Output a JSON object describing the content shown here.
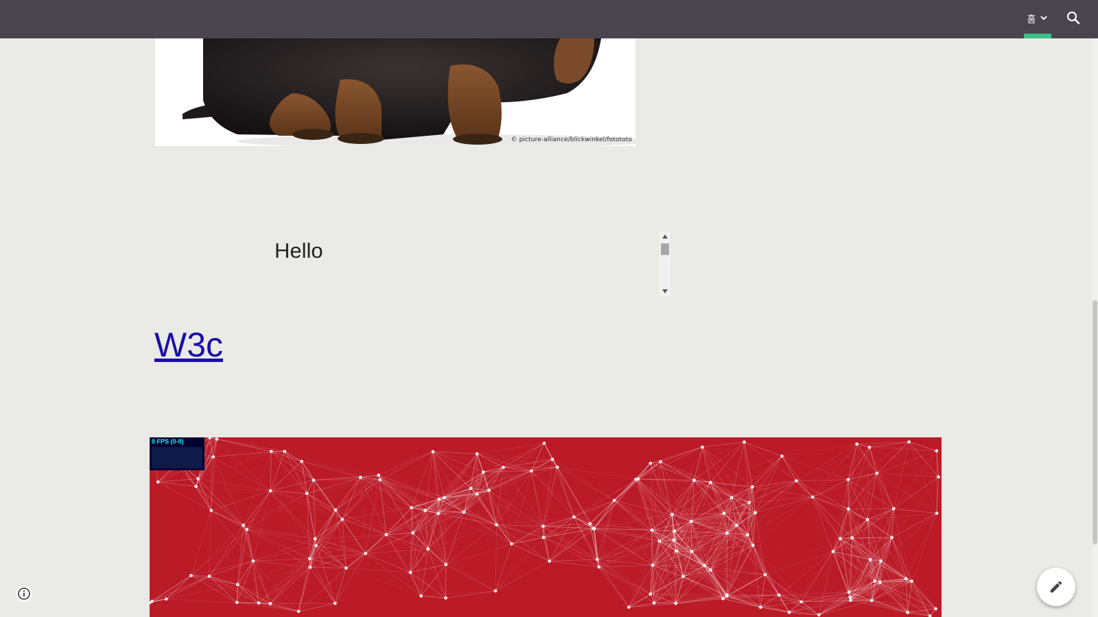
{
  "nav": {
    "home_label": "홈",
    "home_icon": "chevron-down-icon",
    "search_icon": "search-icon",
    "accent_color": "#3cbf86",
    "bar_color": "#4a444f"
  },
  "image": {
    "credit": "© picture-alliance/blickwinkel/fotototo"
  },
  "embed": {
    "text": "Hello"
  },
  "link": {
    "text": "W3c"
  },
  "particles": {
    "fps_text": "0 FPS (0-0)",
    "background_color": "#bb1a27"
  },
  "controls": {
    "info_icon": "info-icon",
    "edit_icon": "pencil-icon"
  }
}
